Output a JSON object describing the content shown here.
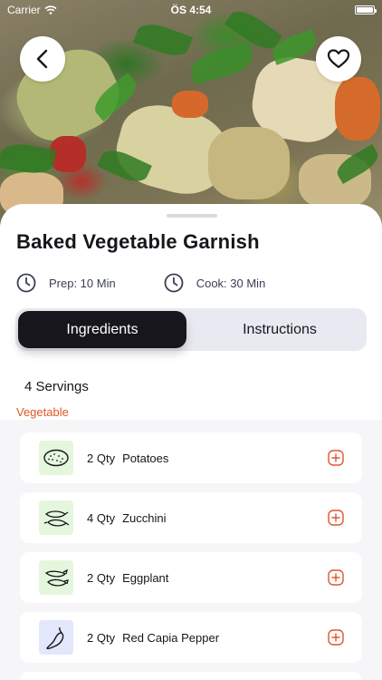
{
  "status_bar": {
    "carrier": "Carrier",
    "time": "ÖS 4:54"
  },
  "recipe": {
    "title": "Baked Vegetable Garnish",
    "prep": "Prep: 10 Min",
    "cook": "Cook: 30 Min"
  },
  "tabs": [
    {
      "label": "Ingredients",
      "active": true
    },
    {
      "label": "Instructions",
      "active": false
    }
  ],
  "servings": "4 Servings",
  "category": "Vegetable",
  "ingredients": [
    {
      "qty": "2 Qty",
      "name": "Potatoes",
      "icon": "potato-icon",
      "thumb_color": "#e4f7dc"
    },
    {
      "qty": "4 Qty",
      "name": "Zucchini",
      "icon": "zucchini-icon",
      "thumb_color": "#e4f7dc"
    },
    {
      "qty": "2 Qty",
      "name": "Eggplant",
      "icon": "eggplant-icon",
      "thumb_color": "#e4f7dc"
    },
    {
      "qty": "2 Qty",
      "name": "Red Capia Pepper",
      "icon": "pepper-icon",
      "thumb_color": "#e3e7fb"
    }
  ],
  "colors": {
    "accent": "#e0562b",
    "dark": "#16161c",
    "tab_bg": "#e9eaf1"
  }
}
